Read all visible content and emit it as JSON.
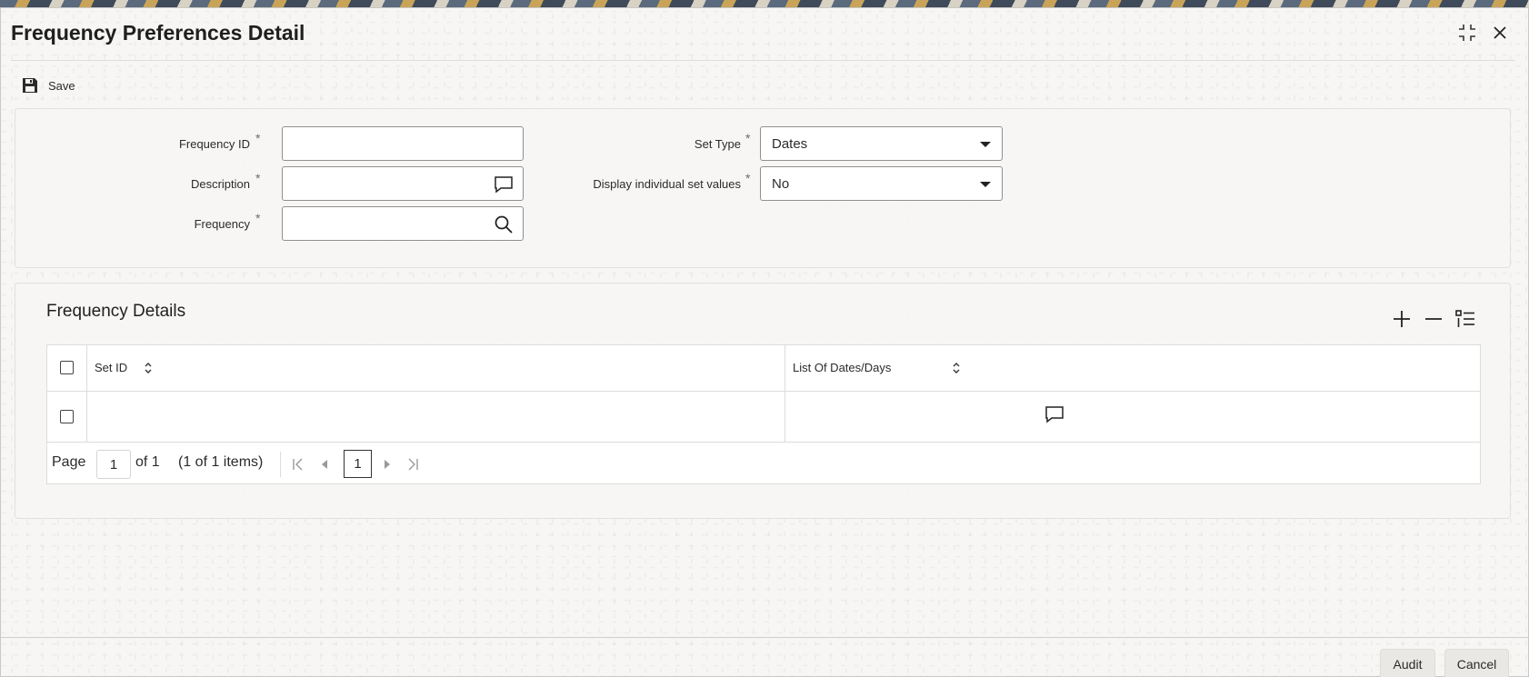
{
  "window": {
    "title": "Frequency Preferences Detail",
    "maximize_icon": "maximize-icon",
    "close_icon": "close-icon"
  },
  "toolbar": {
    "save_label": "Save",
    "save_icon": "floppy-disk-icon"
  },
  "form": {
    "frequency_id": {
      "label": "Frequency ID",
      "required": "*",
      "value": ""
    },
    "description": {
      "label": "Description",
      "required": "*",
      "value": ""
    },
    "frequency": {
      "label": "Frequency",
      "required": "*",
      "value": ""
    },
    "set_type": {
      "label": "Set Type",
      "required": "*",
      "value": "Dates"
    },
    "display_individual": {
      "label": "Display individual set values",
      "required": "*",
      "value": "No"
    }
  },
  "details": {
    "title": "Frequency Details",
    "columns": [
      "Set ID",
      "List Of Dates/Days"
    ],
    "rows": [
      {
        "set_id": "",
        "list_of_dates": ""
      }
    ],
    "pager": {
      "page_label": "Page",
      "current_page": "1",
      "of_label": "of 1",
      "items_label": "(1 of 1 items)",
      "page_button": "1"
    }
  },
  "footer": {
    "audit_label": "Audit",
    "cancel_label": "Cancel"
  }
}
